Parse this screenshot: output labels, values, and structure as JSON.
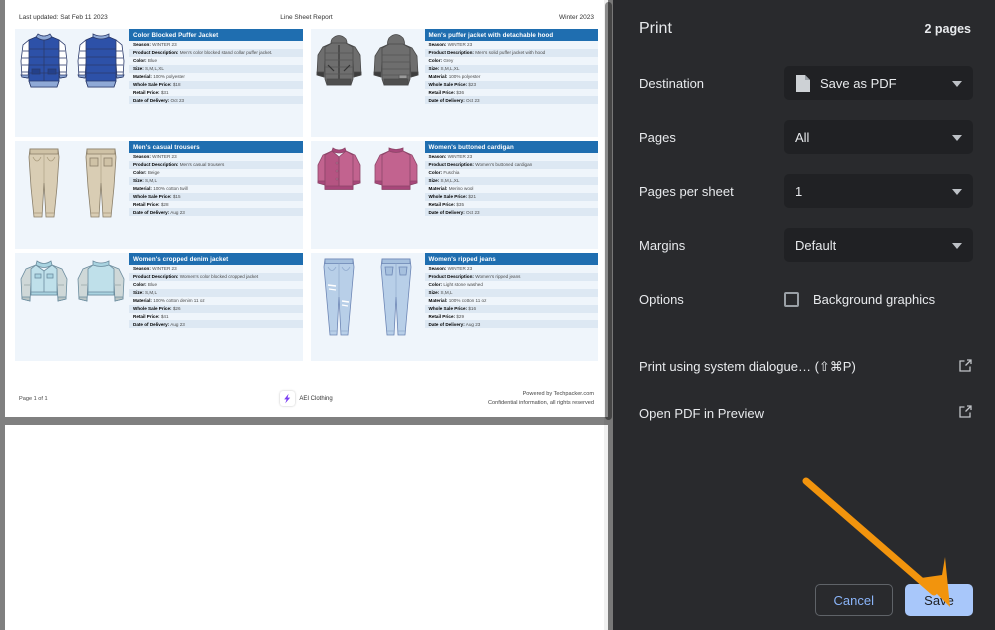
{
  "document": {
    "header": {
      "last_updated": "Last updated: Sat Feb 11 2023",
      "report_title": "Line Sheet Report",
      "season": "Winter 2023"
    },
    "spec_labels": {
      "season": "Season:",
      "description": "Product Description:",
      "color": "Color:",
      "size": "Size:",
      "material": "Material:",
      "wholesale": "Whole Sale Price:",
      "retail": "Retail Price:",
      "delivery": "Date of Delivery:"
    },
    "products": [
      {
        "title": "Color Blocked Puffer Jacket",
        "season": "WINTER 23",
        "description": "Men's color blocked stand collar puffer jacket.",
        "color": "Blue",
        "size": "S,M,L,XL",
        "material": "100% polyester",
        "wholesale": "$18",
        "retail": "$31",
        "delivery": "Oct 23",
        "figure": "puffer-jacket-blue"
      },
      {
        "title": "Men's puffer jacket with detachable hood",
        "season": "WINTER 23",
        "description": "Men's solid puffer jacket with hood",
        "color": "Grey",
        "size": "S,M,L,XL",
        "material": "100% polyester",
        "wholesale": "$23",
        "retail": "$36",
        "delivery": "Oct 23",
        "figure": "hooded-puffer-grey"
      },
      {
        "title": "Men's casual trousers",
        "season": "WINTER 23",
        "description": "Men's casual trousers",
        "color": "Beige",
        "size": "S,M,L",
        "material": "100% cotton twill",
        "wholesale": "$15",
        "retail": "$28",
        "delivery": "Aug 23",
        "figure": "trousers-beige"
      },
      {
        "title": "Women's buttoned cardigan",
        "season": "WINTER 23",
        "description": "Women's buttoned cardigan",
        "color": "Fuschia",
        "size": "S,M,L,XL",
        "material": "Merino wool",
        "wholesale": "$21",
        "retail": "$35",
        "delivery": "Oct 23",
        "figure": "cardigan-fuschia"
      },
      {
        "title": "Women's cropped denim jacket",
        "season": "WINTER 23",
        "description": "Women's color blocked cropped jacket",
        "color": "Blue",
        "size": "S,M,L",
        "material": "100% cotton denim 11 oz",
        "wholesale": "$26",
        "retail": "$41",
        "delivery": "Aug 23",
        "figure": "denim-jacket-lightblue"
      },
      {
        "title": "Women's ripped jeans",
        "season": "WINTER 23",
        "description": "Women's ripped jeans",
        "color": "Light stone washed",
        "size": "S,M,L",
        "material": "100% cotton 11 oz",
        "wholesale": "$16",
        "retail": "$29",
        "delivery": "Aug 23",
        "figure": "ripped-jeans-blue"
      }
    ],
    "footer": {
      "page_indicator": "Page 1 of 1",
      "brand": "AEI Clothing",
      "powered_by": "Powered by Techpacker.com",
      "confidential": "Confidential information, all rights reserved"
    }
  },
  "print_dialog": {
    "title": "Print",
    "page_count": "2 pages",
    "rows": [
      {
        "label": "Destination",
        "value": "Save as PDF",
        "icon": "pdf-file-icon"
      },
      {
        "label": "Pages",
        "value": "All",
        "icon": ""
      },
      {
        "label": "Pages per sheet",
        "value": "1",
        "icon": ""
      },
      {
        "label": "Margins",
        "value": "Default",
        "icon": ""
      }
    ],
    "options": {
      "label": "Options",
      "background_graphics": "Background graphics",
      "background_graphics_checked": false
    },
    "links": [
      {
        "label": "Print using system dialogue… (⇧⌘P)",
        "icon": "external-link-icon"
      },
      {
        "label": "Open PDF in Preview",
        "icon": "external-link-icon"
      }
    ],
    "buttons": {
      "cancel": "Cancel",
      "save": "Save"
    },
    "colors": {
      "panel_bg": "#292a2d",
      "control_bg": "#202124",
      "accent_blue": "#8ab4f8",
      "save_bg": "#a8c7fa",
      "annotation_orange": "#f2940d"
    }
  }
}
